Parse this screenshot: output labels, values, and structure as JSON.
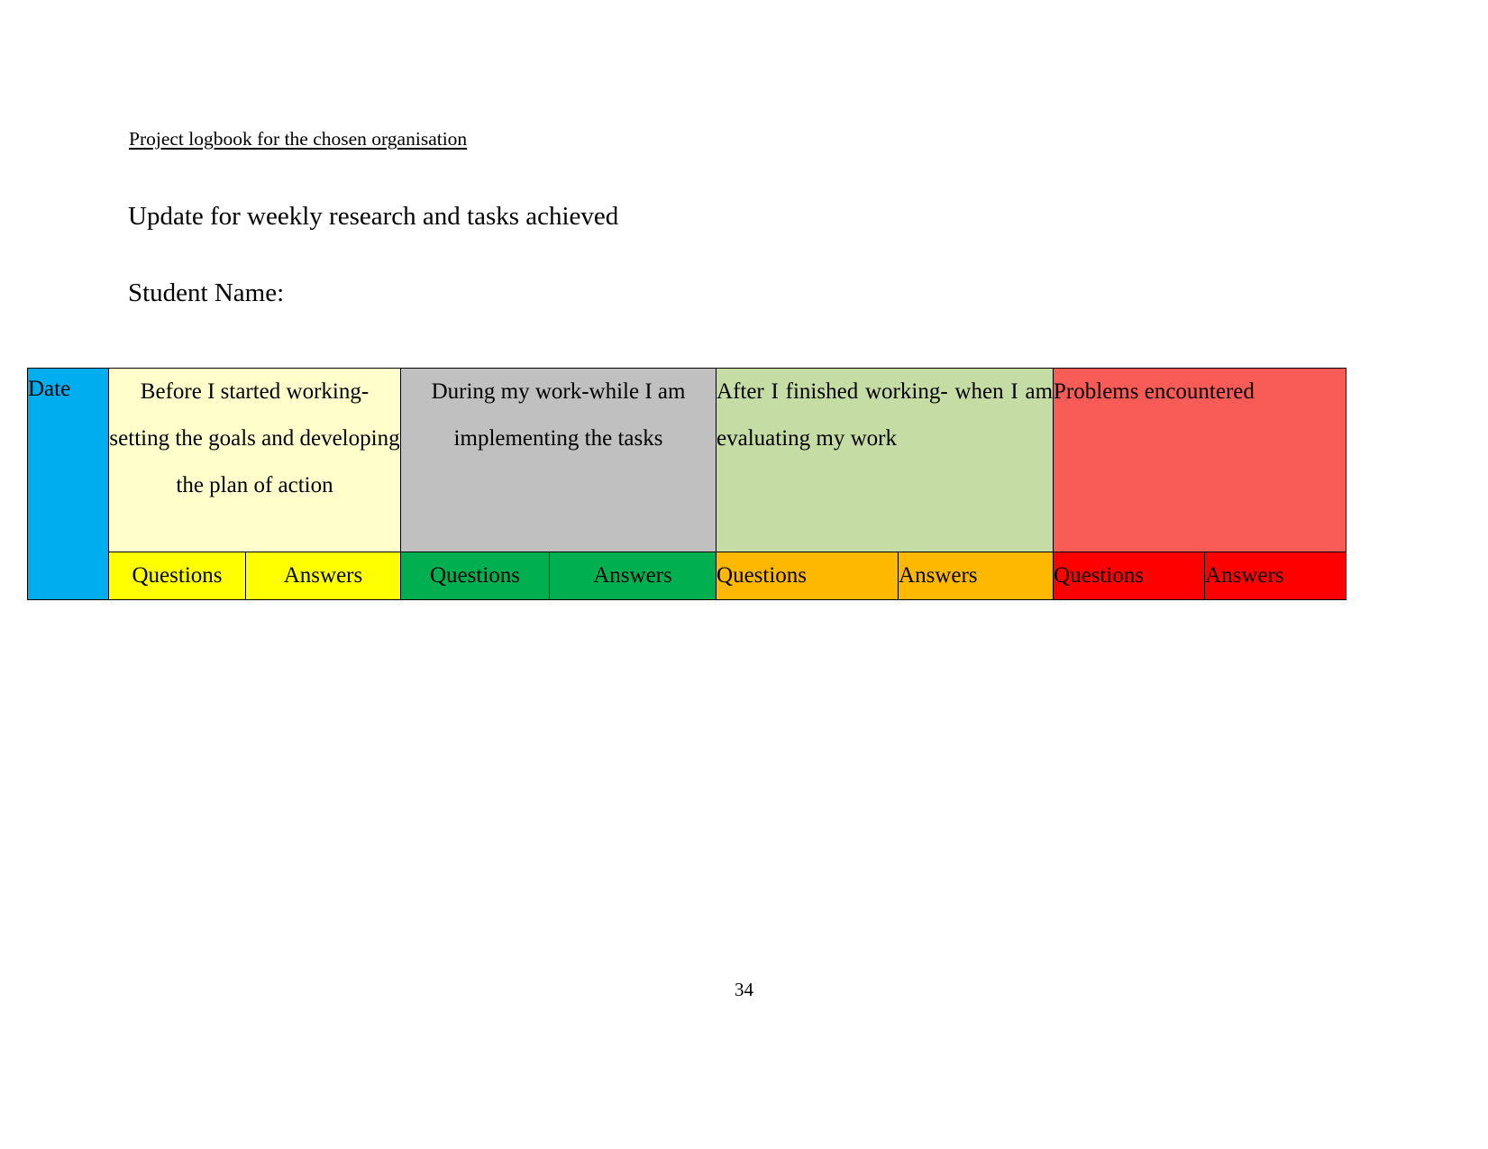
{
  "document": {
    "title": "Project logbook for the chosen organisation",
    "heading_update": "Update for weekly research and tasks achieved",
    "heading_student": "Student Name:",
    "page_number": "34"
  },
  "colors": {
    "date_header": "#00AEEF",
    "before_header": "#FFFFCC",
    "during_header": "#C0C0C0",
    "after_header": "#C5DDA5",
    "problems_header": "#F95B57",
    "sub_before": "#FFFF00",
    "sub_during": "#00B050",
    "sub_after": "#FFB800",
    "sub_problems": "#FF0000",
    "border": "#000000",
    "page_background": "#FFFFFF"
  },
  "table": {
    "headers": [
      {
        "key": "date",
        "label": "Date"
      },
      {
        "key": "before",
        "label": "Before I started working- setting the goals and developing the plan of action"
      },
      {
        "key": "during",
        "label": "During my work-while I am  implementing the tasks"
      },
      {
        "key": "after",
        "label": "After I finished working- when I am evaluating my work"
      },
      {
        "key": "problems",
        "label": "Problems encountered"
      }
    ],
    "subheaders": [
      {
        "group": "before",
        "questions": "Questions",
        "answers": "Answers"
      },
      {
        "group": "during",
        "questions": "Questions",
        "answers": "Answers"
      },
      {
        "group": "after",
        "questions": "Questions",
        "answers": "Answers"
      },
      {
        "group": "problems",
        "questions": "Questions",
        "answers": "Answers"
      }
    ]
  }
}
